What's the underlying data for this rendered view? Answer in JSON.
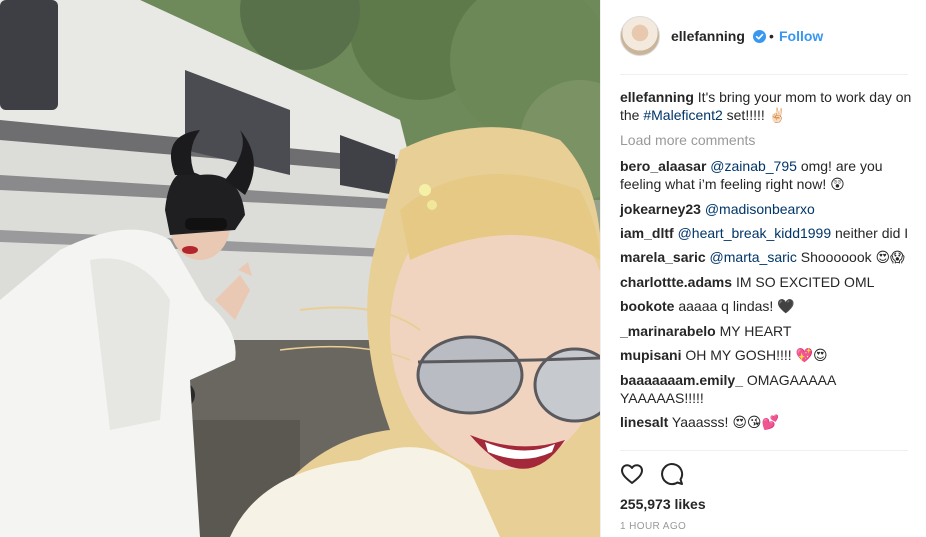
{
  "post": {
    "author": "ellefanning",
    "follow_label": "Follow",
    "separator": "•",
    "caption": {
      "user": "ellefanning",
      "text": "It's bring your mom to work day on the",
      "hashtag": "#Maleficent2",
      "text_after": "set!!!!!",
      "emoji": "✌🏻"
    },
    "load_more": "Load more comments",
    "comments": [
      {
        "user": "bero_alaasar",
        "mention": "@zainab_795",
        "text": "omg! are you feeling what i’m feeling right now!",
        "emoji": "😲"
      },
      {
        "user": "jokearney23",
        "mention": "@madisonbearxo",
        "text": "",
        "emoji": ""
      },
      {
        "user": "iam_dltf",
        "mention": "@heart_break_kidd1999",
        "text": "neither did I",
        "emoji": ""
      },
      {
        "user": "marela_saric",
        "mention": "@marta_saric",
        "text": "Shooooook",
        "emoji": "😍😱"
      },
      {
        "user": "charlottte.adams",
        "mention": "",
        "text": "IM SO EXCITED OML",
        "emoji": ""
      },
      {
        "user": "bookote",
        "mention": "",
        "text": "aaaaa q lindas!",
        "emoji": "🖤"
      },
      {
        "user": "_marinarabelo",
        "mention": "",
        "text": "MY HEART",
        "emoji": ""
      },
      {
        "user": "mupisani",
        "mention": "",
        "text": "OH MY GOSH!!!!",
        "emoji": "💖😍"
      },
      {
        "user": "baaaaaaam.emily_",
        "mention": "",
        "text": "OMAGAAAAA YAAAAAS!!!!!",
        "emoji": ""
      },
      {
        "user": "linesalt",
        "mention": "",
        "text": "Yaaasss!",
        "emoji": "😍😘💕"
      }
    ],
    "likes": "255,973 likes",
    "timestamp": "1 HOUR AGO",
    "icons": {
      "like": "heart-icon",
      "comment": "comment-icon",
      "verified": "verified-badge-icon"
    },
    "colors": {
      "link": "#3897f0",
      "mention": "#003569",
      "muted": "#999999",
      "text": "#262626"
    }
  }
}
